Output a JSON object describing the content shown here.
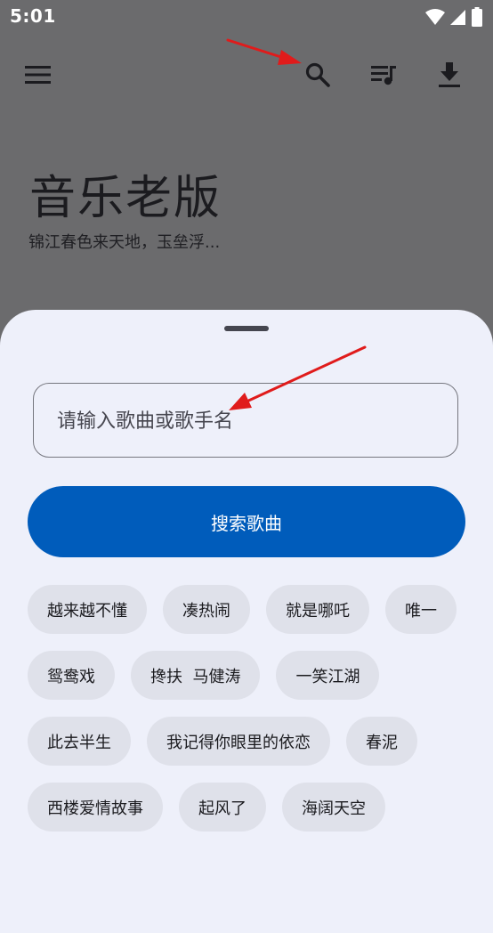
{
  "status_bar": {
    "time": "5:01",
    "icons": [
      "wifi-icon",
      "signal-icon",
      "battery-icon"
    ]
  },
  "app_bar": {
    "icons": [
      "menu-icon",
      "search-icon",
      "queue-music-icon",
      "download-icon"
    ]
  },
  "header": {
    "title": "音乐老版",
    "subtitle": "锦江春色来天地，玉垒浮..."
  },
  "search_sheet": {
    "input": {
      "placeholder": "请输入歌曲或歌手名",
      "value": ""
    },
    "search_button_label": "搜索歌曲",
    "suggestions": [
      "越来越不懂",
      "凑热闹",
      "就是哪吒",
      "唯一",
      "鸳鸯戏",
      "搀扶  马健涛",
      "一笑江湖",
      "此去半生",
      "我记得你眼里的依恋",
      "春泥",
      "西楼爱情故事",
      "起风了",
      "海阔天空"
    ]
  },
  "colors": {
    "scrim": "#6b6b6d",
    "sheet_background": "#eef0fa",
    "primary_button": "#005cbb",
    "chip_background": "#dfe1ea",
    "annotation_arrow": "#e01b1b"
  }
}
